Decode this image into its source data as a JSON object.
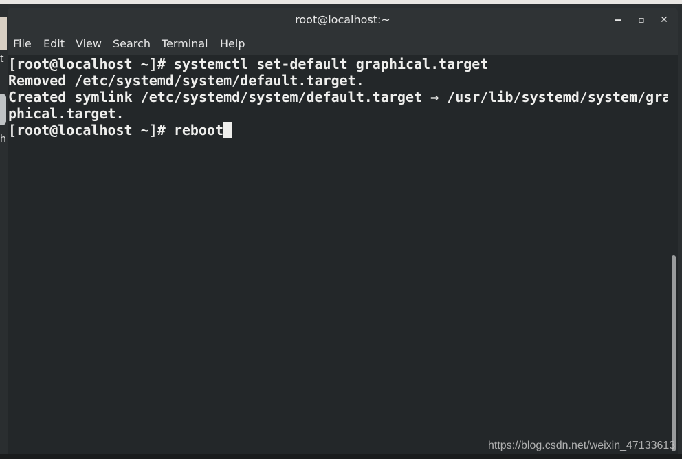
{
  "window": {
    "title": "root@localhost:~",
    "controls": {
      "minimize": "‒",
      "maximize": "▫",
      "close": "✕"
    }
  },
  "menubar": {
    "items": [
      "File",
      "Edit",
      "View",
      "Search",
      "Terminal",
      "Help"
    ]
  },
  "terminal": {
    "lines": [
      "[root@localhost ~]# systemctl set-default graphical.target",
      "Removed /etc/systemd/system/default.target.",
      "Created symlink /etc/systemd/system/default.target → /usr/lib/systemd/system/gra",
      "phical.target.",
      "[root@localhost ~]# reboot"
    ],
    "colors": {
      "background": "#232729",
      "foreground": "#eeeeec"
    }
  },
  "desktop": {
    "partial_labels": [
      "t",
      "h"
    ]
  },
  "watermark": "https://blog.csdn.net/weixin_47133613"
}
